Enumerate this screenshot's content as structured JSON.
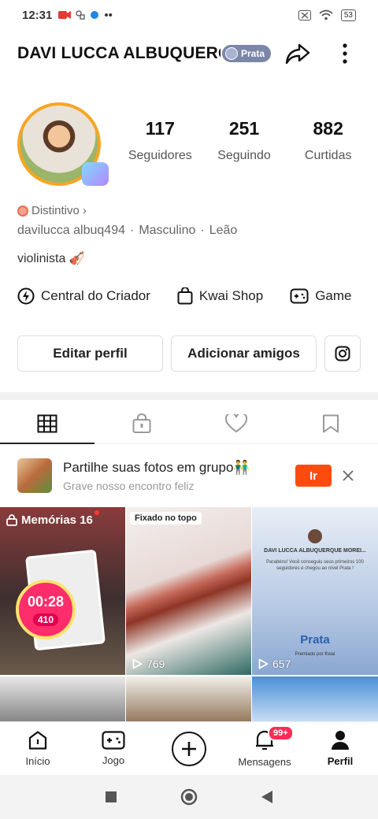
{
  "status_bar": {
    "time": "12:31",
    "battery": "53"
  },
  "profile": {
    "name": "DAVI LUCCA ALBUQUERQUE MOREIRA",
    "level_badge": "Prata",
    "followers": "117",
    "followers_label": "Seguidores",
    "following": "251",
    "following_label": "Seguindo",
    "likes": "882",
    "likes_label": "Curtidas",
    "distintivo": "Distintivo",
    "username": "davilucca albuq494",
    "gender": "Masculino",
    "sign": "Leão",
    "bio": "violinista 🎻"
  },
  "quick_links": [
    {
      "label": "Central do Criador"
    },
    {
      "label": "Kwai Shop"
    },
    {
      "label": "Game"
    }
  ],
  "actions": {
    "edit": "Editar perfil",
    "add_friends": "Adicionar amigos"
  },
  "promo": {
    "title": "Partilhe suas fotos em grupo👬",
    "subtitle": "Grave nosso encontro feliz",
    "button": "Ir"
  },
  "grid": {
    "memories_label": "Memórias 16",
    "timer": "00:28",
    "coins": "410",
    "pinned_label": "Fixado no topo",
    "plays_2": "769",
    "plays_3": "657",
    "card_title": "DAVI LUCCA ALBUQUERQUE MOREI...",
    "card_body": "Parabéns! Você conseguiu seus primeiros 100 seguidores e chegou ao nível Prata !",
    "card_level": "Prata",
    "card_by": "Premiado por Kwai"
  },
  "bottom_nav": {
    "home": "Início",
    "games": "Jogo",
    "messages": "Mensagens",
    "messages_badge": "99+",
    "profile": "Perfil"
  },
  "colors": {
    "accent": "#ff4b0f",
    "badge_red": "#ff2b55",
    "prata": "#7b86a8"
  }
}
